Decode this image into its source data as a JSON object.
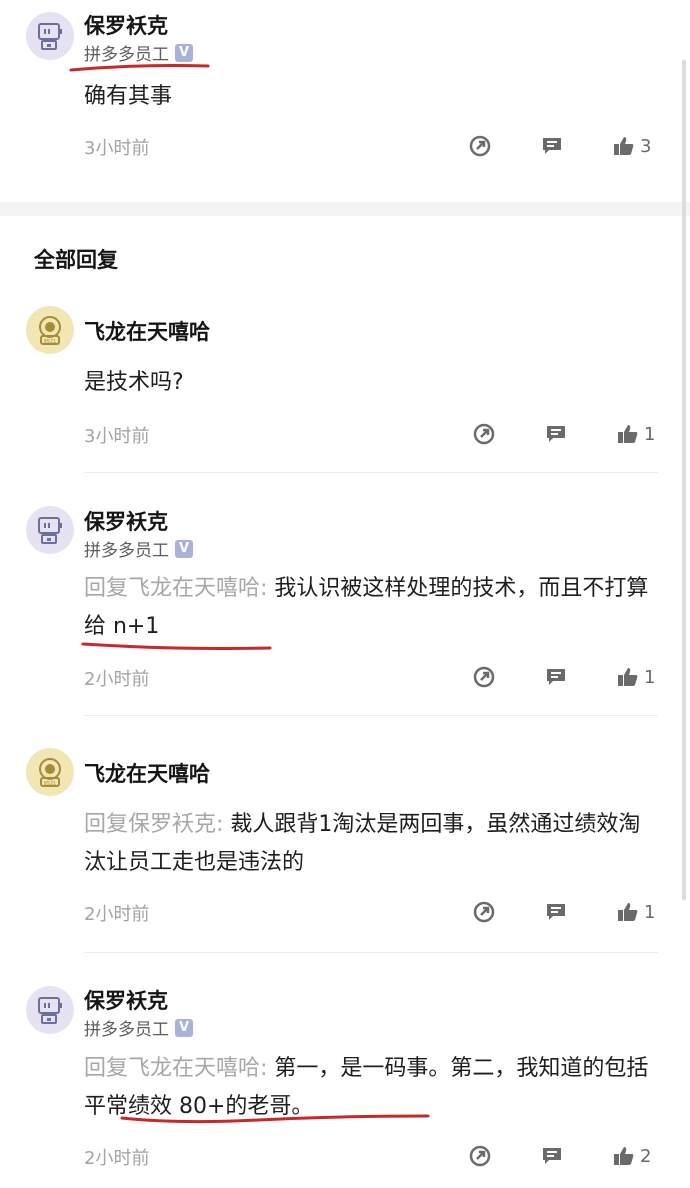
{
  "top_comment": {
    "name": "保罗袄克",
    "role": "拼多多员工",
    "badge": "V",
    "text": "确有其事",
    "time": "3小时前",
    "likes": "3"
  },
  "section_title": "全部回复",
  "replies": [
    {
      "name": "飞龙在天嘻哈",
      "text": "是技术吗?",
      "time": "3小时前",
      "likes": "1"
    },
    {
      "name": "保罗袄克",
      "role": "拼多多员工",
      "badge": "V",
      "prefix": "回复飞龙在天嘻哈:",
      "text": "我认识被这样处理的技术，而且不打算给 n+1",
      "time": "2小时前",
      "likes": "1"
    },
    {
      "name": "飞龙在天嘻哈",
      "prefix": "回复保罗袄克:",
      "text": "裁人跟背1淘汰是两回事，虽然通过绩效淘汰让员工走也是违法的",
      "time": "2小时前",
      "likes": "1"
    },
    {
      "name": "保罗袄克",
      "role": "拼多多员工",
      "badge": "V",
      "prefix": "回复飞龙在天嘻哈:",
      "text": "第一，是一码事。第二，我知道的包括平常绩效 80+的老哥。",
      "time": "2小时前",
      "likes": "2"
    }
  ],
  "avatar_labels": {
    "astro": "9521"
  },
  "colors": {
    "annotation": "#c8282a",
    "badge": "#a9b3d8",
    "section_gap": "#f4f4f4"
  },
  "icons": [
    "share-icon",
    "comment-icon",
    "thumbs-up-icon",
    "robot-avatar-icon",
    "astronaut-avatar-icon"
  ]
}
